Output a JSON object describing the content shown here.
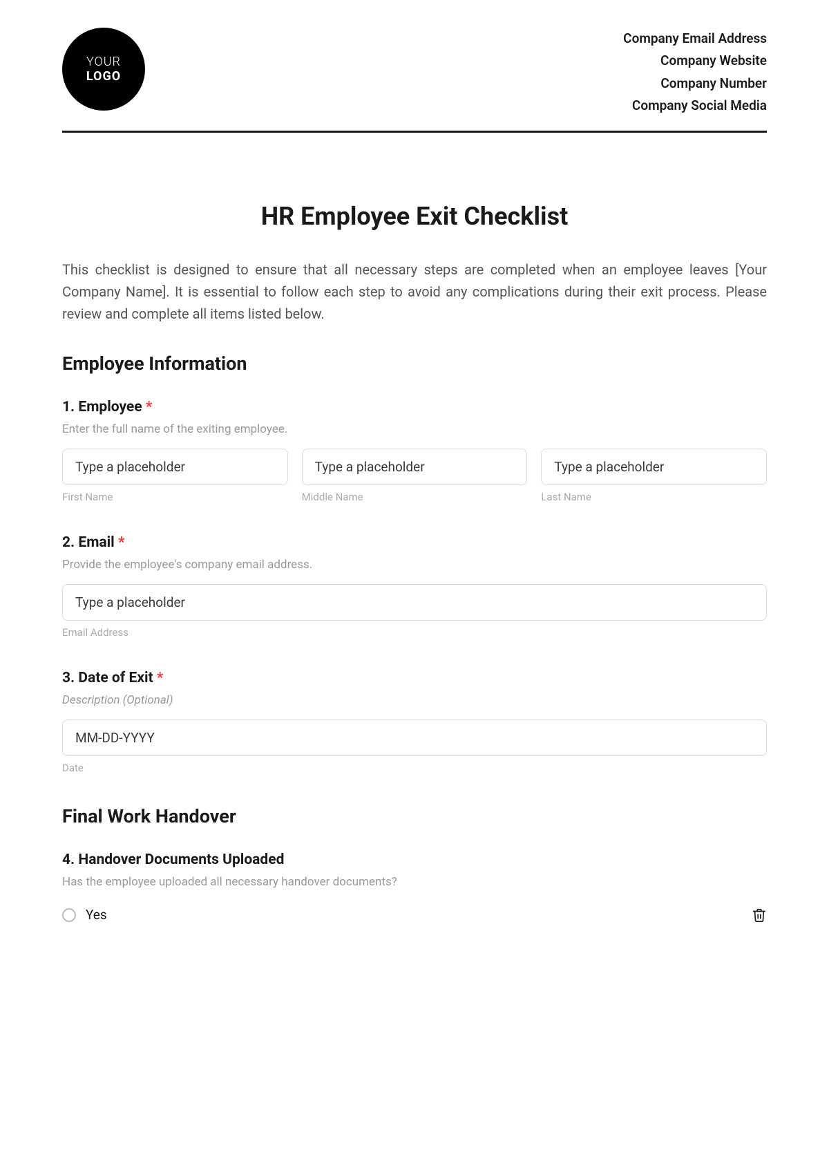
{
  "header": {
    "logo": {
      "line1": "YOUR",
      "line2": "LOGO"
    },
    "company": {
      "email": "Company Email Address",
      "website": "Company Website",
      "number": "Company Number",
      "social": "Company Social Media"
    }
  },
  "title": "HR Employee Exit Checklist",
  "intro": "This checklist is designed to ensure that all necessary steps are completed when an employee leaves [Your Company Name]. It is essential to follow each step to avoid any complications during their exit process. Please review and complete all items listed below.",
  "sections": {
    "employee_info": {
      "title": "Employee Information",
      "questions": {
        "employee": {
          "number": "1.",
          "label": "Employee",
          "required": "*",
          "desc": "Enter the full name of the exiting employee.",
          "fields": {
            "first": {
              "placeholder": "Type a placeholder",
              "label": "First Name"
            },
            "middle": {
              "placeholder": "Type a placeholder",
              "label": "Middle Name"
            },
            "last": {
              "placeholder": "Type a placeholder",
              "label": "Last Name"
            }
          }
        },
        "email": {
          "number": "2.",
          "label": "Email",
          "required": "*",
          "desc": "Provide the employee's company email address.",
          "field": {
            "placeholder": "Type a placeholder",
            "label": "Email Address"
          }
        },
        "date_exit": {
          "number": "3.",
          "label": "Date of Exit",
          "required": "*",
          "desc": "Description (Optional)",
          "field": {
            "placeholder": "MM-DD-YYYY",
            "label": "Date"
          }
        }
      }
    },
    "handover": {
      "title": "Final Work Handover",
      "questions": {
        "documents": {
          "number": "4.",
          "label": "Handover Documents Uploaded",
          "desc": "Has the employee uploaded all necessary handover documents?",
          "options": {
            "yes": "Yes"
          }
        }
      }
    }
  }
}
